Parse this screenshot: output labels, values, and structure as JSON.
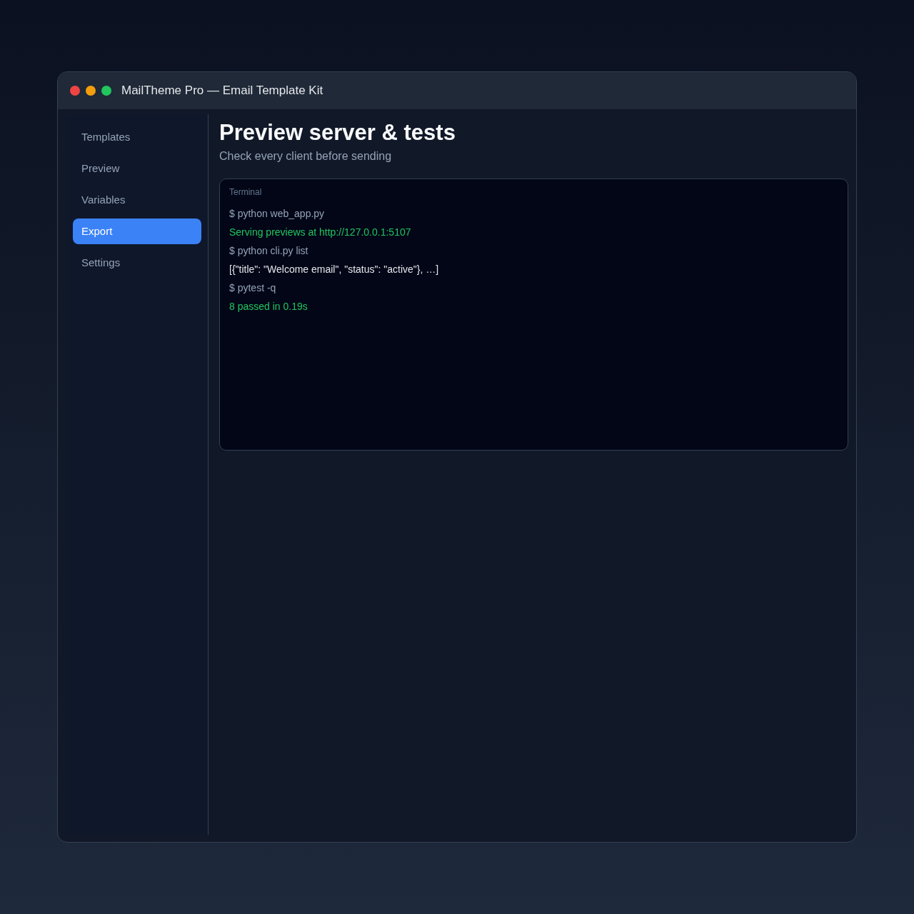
{
  "window": {
    "title": "MailTheme Pro — Email Template Kit"
  },
  "sidebar": {
    "items": [
      {
        "label": "Templates",
        "selected": false
      },
      {
        "label": "Preview",
        "selected": false
      },
      {
        "label": "Variables",
        "selected": false
      },
      {
        "label": "Export",
        "selected": true
      },
      {
        "label": "Settings",
        "selected": false
      }
    ]
  },
  "main": {
    "heading": "Preview server & tests",
    "subtitle": "Check every client before sending"
  },
  "terminal": {
    "label": "Terminal",
    "lines": [
      {
        "kind": "command",
        "text": "$ python web_app.py"
      },
      {
        "kind": "success",
        "text": "Serving previews at http://127.0.0.1:5107"
      },
      {
        "kind": "command",
        "text": "$ python cli.py list"
      },
      {
        "kind": "output",
        "text": "[{\"title\": \"Welcome email\", \"status\": \"active\"}, …]"
      },
      {
        "kind": "command",
        "text": "$ pytest -q"
      },
      {
        "kind": "success",
        "text": "8 passed in 0.19s"
      }
    ]
  }
}
